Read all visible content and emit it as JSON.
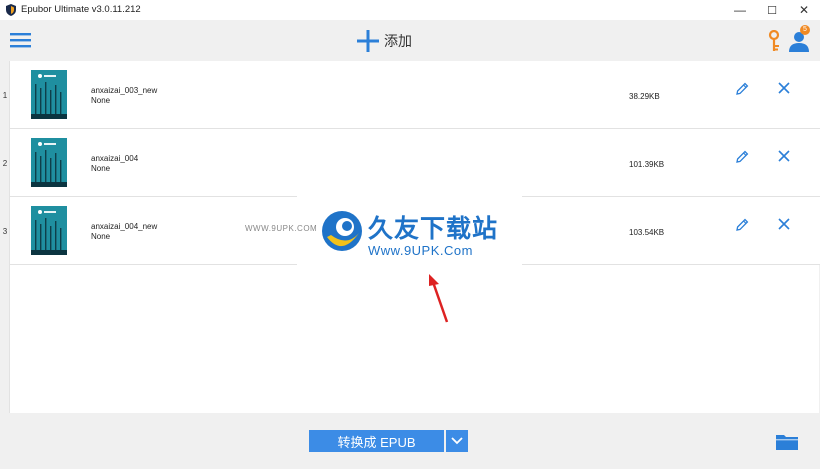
{
  "window": {
    "title": "Epubor Ultimate v3.0.11.212",
    "controls": {
      "minimize": "—",
      "maximize": "☐",
      "close": "✕"
    }
  },
  "toolbar": {
    "menu_icon": "hamburger-menu-icon",
    "add_label": "添加",
    "key_icon": "key-icon",
    "user_icon": "user-icon",
    "notification_count": "5"
  },
  "books": [
    {
      "index": "1",
      "title": "anxaizai_003_new",
      "author": "None",
      "size": "38.29KB"
    },
    {
      "index": "2",
      "title": "anxaizai_004",
      "author": "None",
      "size": "101.39KB"
    },
    {
      "index": "3",
      "title": "anxaizai_004_new",
      "author": "None",
      "size": "103.54KB"
    }
  ],
  "watermark": {
    "small_url": "WWW.9UPK.COM",
    "chinese": "久友下载站",
    "url": "Www.9UPK.Com"
  },
  "footer": {
    "convert_label": "转换成 EPUB",
    "dropdown_icon": "chevron-down-icon",
    "folder_icon": "folder-icon"
  },
  "colors": {
    "accent": "#3c8ce6",
    "icon_blue": "#2b7fd8",
    "key_orange": "#f08a24",
    "cover_teal": "#1f8fa0",
    "background": "#f0f0f0"
  }
}
